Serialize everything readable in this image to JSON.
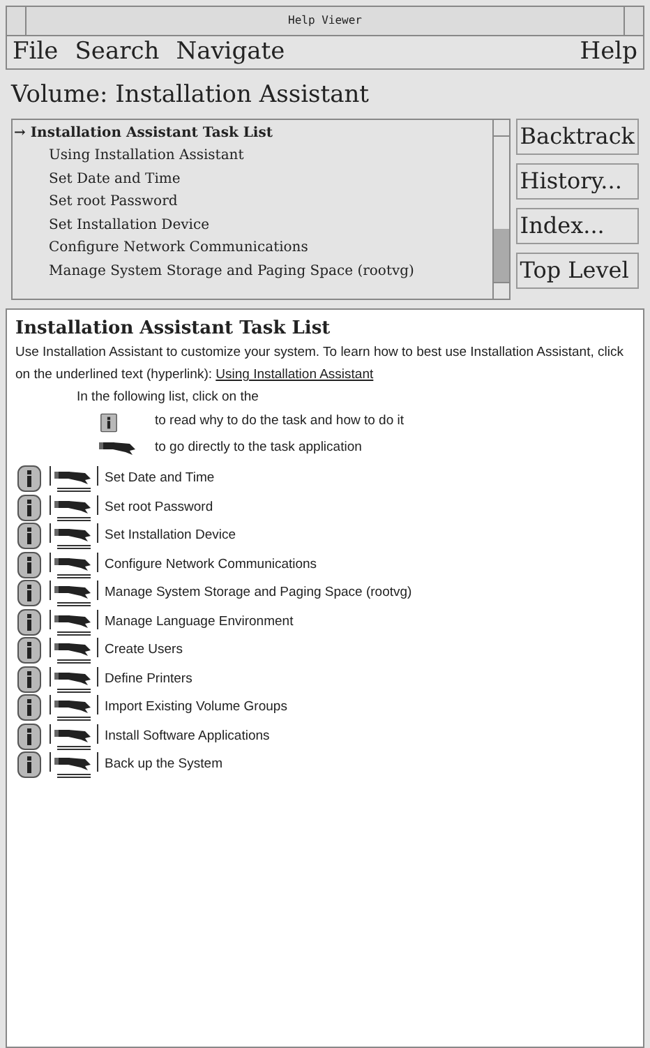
{
  "window": {
    "title": "Help Viewer"
  },
  "menu": [
    {
      "label": "File"
    },
    {
      "label": "Search"
    },
    {
      "label": "Navigate"
    }
  ],
  "help_menu": {
    "label": "Help"
  },
  "volume": "Volume:  Installation Assistant",
  "topics": [
    {
      "label": "Installation Assistant Task List",
      "current": true
    },
    {
      "label": "Using Installation Assistant",
      "current": false
    },
    {
      "label": "Set Date and Time",
      "current": false
    },
    {
      "label": "Set root Password",
      "current": false
    },
    {
      "label": "Set Installation Device",
      "current": false
    },
    {
      "label": "Configure Network Communications",
      "current": false
    },
    {
      "label": "Manage System Storage and Paging Space (rootvg)",
      "current": false
    }
  ],
  "current_marker": "→",
  "buttons": [
    "Backtrack",
    "History...",
    "Index...",
    "Top Level"
  ],
  "content": {
    "heading": "Installation Assistant Task List",
    "intro": "Use Installation Assistant to customize your system. To learn how to best use Installation Assistant, click on the underlined text (hyperlink):",
    "intro_link": "Using Installation Assistant",
    "legend_intro": "In the following list, click on the",
    "legend": [
      {
        "kind": "info",
        "text": "to read why to do the task and how to do it"
      },
      {
        "kind": "task",
        "text": "to go directly to the task application"
      }
    ],
    "tasks": [
      "Set Date and Time",
      "Set root Password",
      "Set Installation Device",
      "Configure Network Communications",
      "Manage System Storage and Paging Space (rootvg)",
      "Manage Language Environment",
      "Create Users",
      "Define Printers",
      "Import Existing Volume Groups",
      "Install Software Applications",
      "Back up the System"
    ]
  }
}
